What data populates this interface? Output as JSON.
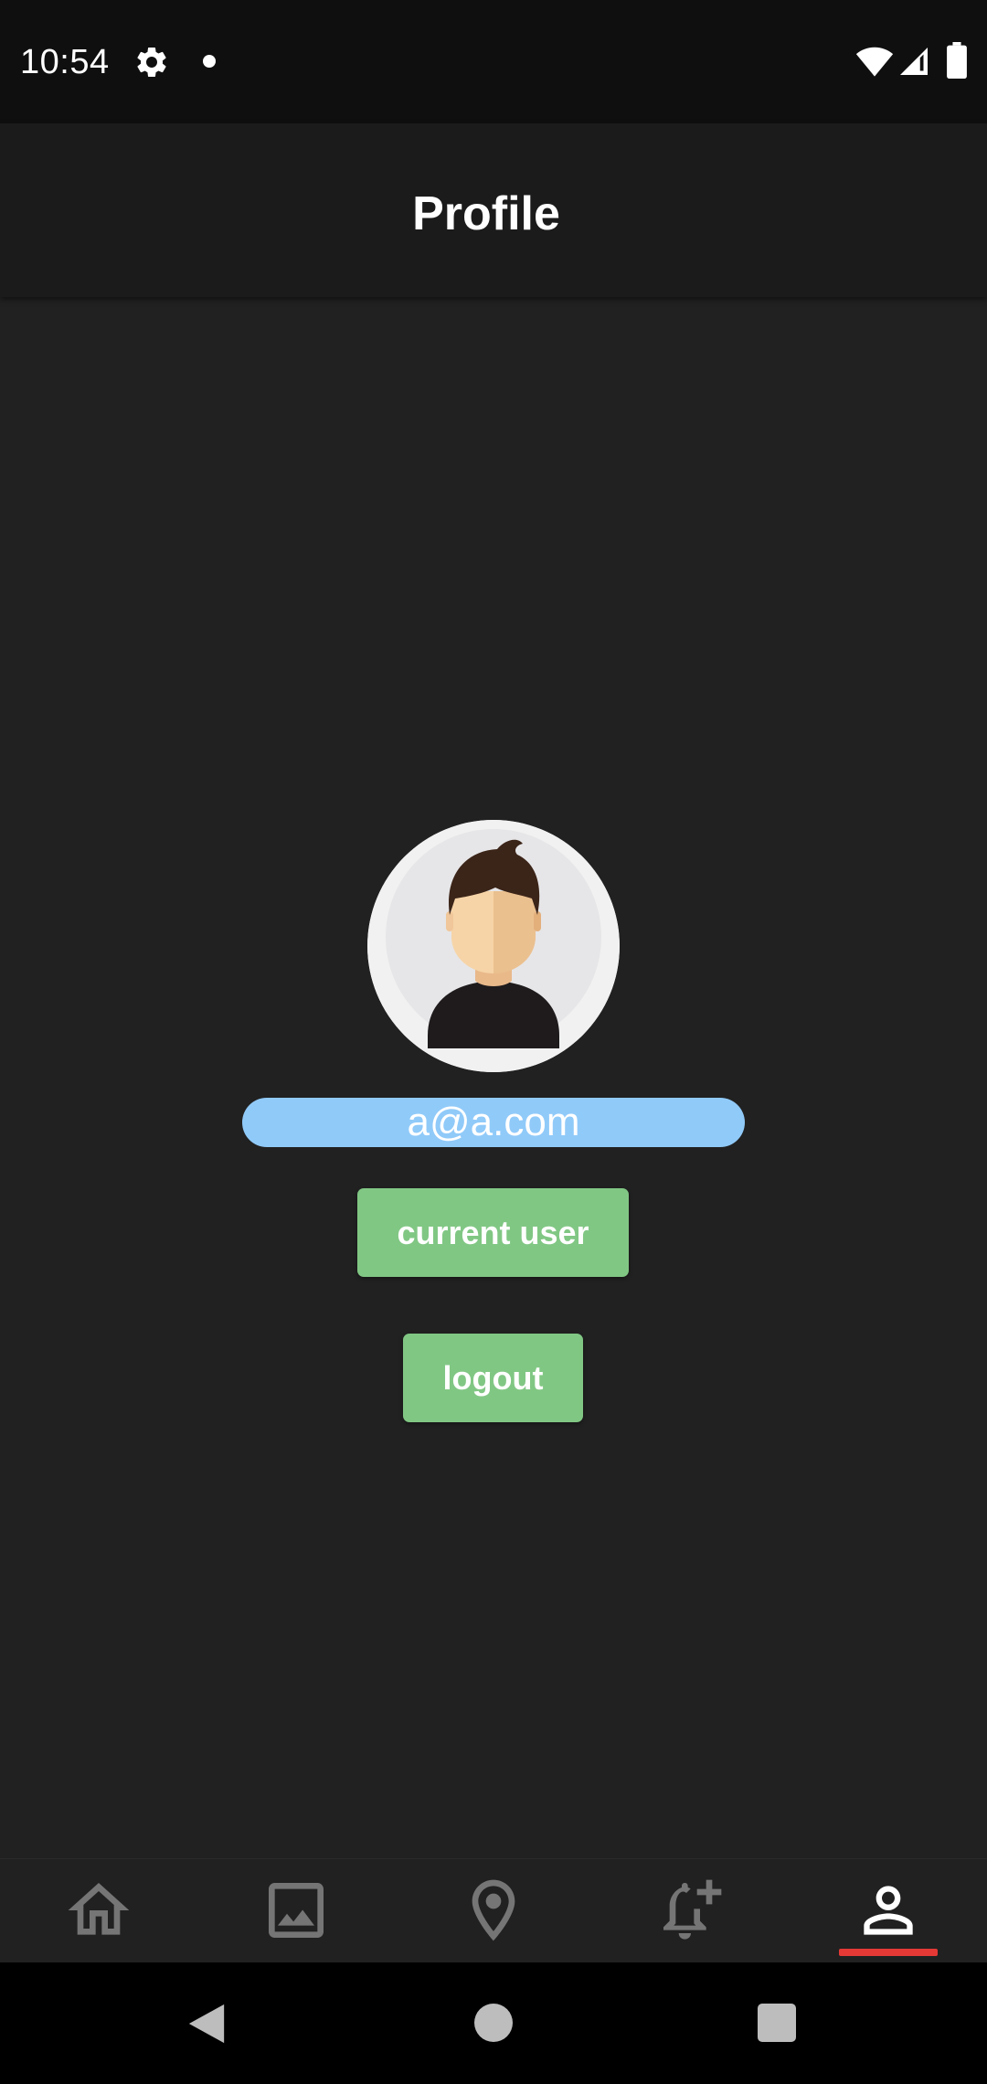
{
  "status_bar": {
    "time": "10:54",
    "icons": [
      "gear-icon",
      "notification-dot",
      "wifi-icon",
      "signal-icon",
      "battery-icon"
    ]
  },
  "app_bar": {
    "title": "Profile"
  },
  "profile": {
    "avatar_icon": "user-avatar",
    "email": "a@a.com",
    "current_user_label": "current user",
    "logout_label": "logout"
  },
  "bottom_nav": {
    "items": [
      {
        "icon": "home-icon",
        "active": false
      },
      {
        "icon": "image-icon",
        "active": false
      },
      {
        "icon": "location-pin-icon",
        "active": false
      },
      {
        "icon": "add-alarm-icon",
        "active": false
      },
      {
        "icon": "person-icon",
        "active": true
      }
    ]
  },
  "system_nav": {
    "buttons": [
      "back",
      "home",
      "recents"
    ]
  },
  "colors": {
    "background": "#212121",
    "app_bar": "#1b1b1b",
    "status_bar": "#0f0f0f",
    "email_pill": "#90caf9",
    "button": "#81c784",
    "active_indicator": "#e53935",
    "inactive_icon": "#757575",
    "active_icon": "#ffffff"
  }
}
